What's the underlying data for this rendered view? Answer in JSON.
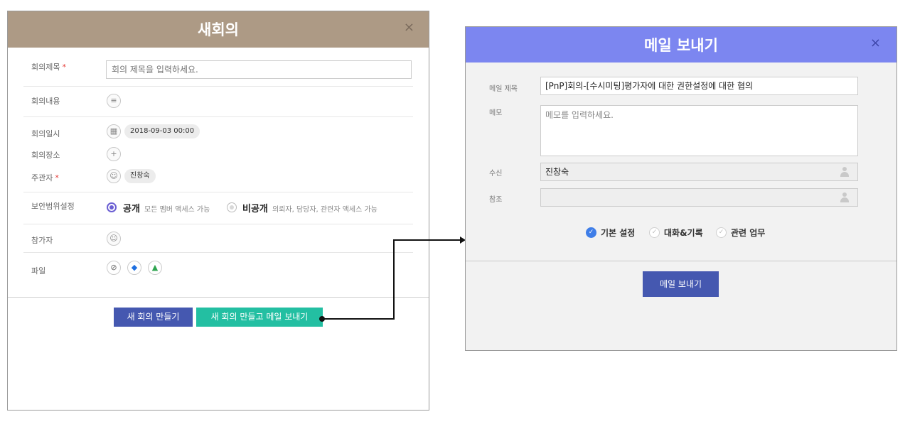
{
  "new_meeting": {
    "title": "새회의",
    "close": "×",
    "fields": {
      "title_label": "회의제목",
      "title_required": "*",
      "title_placeholder": "회의 제목을 입력하세요.",
      "content_label": "회의내용",
      "datetime_label": "회의일시",
      "datetime_value": "2018-09-03 00:00",
      "place_label": "회의장소",
      "host_label": "주관자",
      "host_required": "*",
      "host_value": "진창숙",
      "security_label": "보안범위설정",
      "security_options": [
        {
          "title": "공개",
          "desc": "모든 멤버 액세스 가능",
          "selected": true
        },
        {
          "title": "비공개",
          "desc": "의뢰자, 담당자, 관련자 액세스 가능",
          "selected": false
        }
      ],
      "participants_label": "참가자",
      "files_label": "파일"
    },
    "buttons": {
      "create": "새 회의 만들기",
      "create_and_mail": "새 회의 만들고 메일 보내기"
    },
    "colors": {
      "header": "#ad9a85",
      "create": "#4558b0",
      "create_and_mail": "#23bfa2"
    }
  },
  "send_mail": {
    "title": "메일 보내기",
    "close": "×",
    "subject_label": "메일 제목",
    "subject_value": "[PnP]회의-[수시미팅]평가자에 대한 권한설정에 대한 협의",
    "memo_label": "메모",
    "memo_placeholder": "메모를 입력하세요.",
    "to_label": "수신",
    "to_value": "진창숙",
    "cc_label": "참조",
    "cc_value": "",
    "options": [
      {
        "label": "기본 설정",
        "checked": true
      },
      {
        "label": "대화&기록",
        "checked": false
      },
      {
        "label": "관련 업무",
        "checked": false
      }
    ],
    "send_button": "메일 보내기",
    "colors": {
      "header": "#7c86f0",
      "send": "#4558b0",
      "check": "#3f7ee8"
    }
  }
}
